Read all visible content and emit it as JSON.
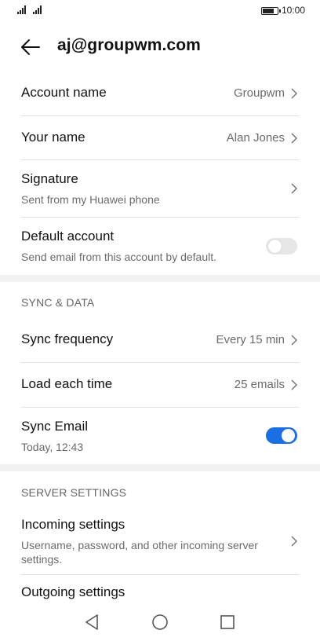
{
  "status_bar": {
    "time": "10:00",
    "battery_level": 0.85
  },
  "header": {
    "title": "aj@groupwm.com"
  },
  "account": {
    "account_name": {
      "label": "Account name",
      "value": "Groupwm"
    },
    "your_name": {
      "label": "Your name",
      "value": "Alan Jones"
    },
    "signature": {
      "label": "Signature",
      "value": "Sent from my Huawei phone"
    },
    "default_account": {
      "label": "Default account",
      "description": "Send email from this account by default.",
      "enabled": false
    }
  },
  "sync": {
    "header": "SYNC & DATA",
    "frequency": {
      "label": "Sync frequency",
      "value": "Every 15 min"
    },
    "load_each_time": {
      "label": "Load each time",
      "value": "25 emails"
    },
    "sync_email": {
      "label": "Sync Email",
      "last_synced": "Today, 12:43",
      "enabled": true
    }
  },
  "server": {
    "header": "SERVER SETTINGS",
    "incoming": {
      "label": "Incoming settings",
      "description": "Username, password, and other incoming server settings."
    },
    "outgoing": {
      "label": "Outgoing settings"
    }
  },
  "colors": {
    "accent": "#1a6fe3",
    "toggle_off": "#e6e6e6",
    "separator_band": "#f1f1f1",
    "secondary_text": "#6b6b6b"
  },
  "icons": {
    "back": "back-arrow-icon",
    "chevron": "chevron-right-icon",
    "nav_back": "triangle-back-icon",
    "nav_home": "circle-home-icon",
    "nav_recents": "square-recents-icon"
  }
}
